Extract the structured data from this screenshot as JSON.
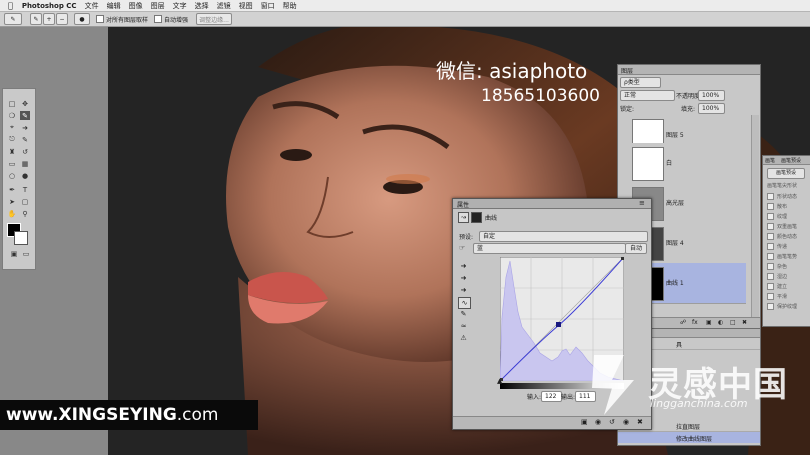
{
  "menubar": {
    "app_name": "Photoshop CC",
    "items": [
      "文件",
      "编辑",
      "图像",
      "图层",
      "文字",
      "选择",
      "滤镜",
      "视图",
      "窗口",
      "帮助"
    ]
  },
  "options_bar": {
    "sample_all_layers": "对所有图层取样",
    "auto_enhance": "自动增强",
    "refine_edge": "调整边缘..."
  },
  "overlay": {
    "wechat_label": "微信:",
    "wechat_id": "asiaphoto",
    "phone": "18565103600",
    "website_main": "www.XINGSEYING",
    "website_tld": ".com",
    "logo_cn": "灵感中国",
    "logo_en": "lingganchina.com"
  },
  "layers_panel": {
    "tab": "图层",
    "filter": "ρ类型",
    "blend_mode": "正常",
    "opacity_label": "不透明度:",
    "opacity": "100%",
    "lock_label": "锁定:",
    "fill_label": "填充:",
    "fill": "100%",
    "layers": [
      {
        "name": "图层 5"
      },
      {
        "name": "白"
      },
      {
        "name": "高光层"
      },
      {
        "name": "图层 4"
      },
      {
        "name": "曲线 1"
      }
    ]
  },
  "brush_panel": {
    "tabs": [
      "画笔",
      "画笔预设"
    ],
    "preset_button": "画笔预设",
    "items": [
      "画笔笔尖形状",
      "形状动态",
      "散布",
      "纹理",
      "双重画笔",
      "颜色动态",
      "传递",
      "画笔笔势",
      "杂色",
      "湿边",
      "建立",
      "平滑",
      "保护纹理"
    ]
  },
  "properties_panel": {
    "tab": "属性",
    "title": "曲线",
    "preset_label": "预设:",
    "preset_value": "自定",
    "channel_value": "蓝",
    "auto_button": "自动",
    "input_label": "输入:",
    "input_value": "122",
    "output_label": "输出:",
    "output_value": "111"
  },
  "history_panel": {
    "items": [
      "具",
      "拉直图层",
      "修改曲线图层"
    ]
  },
  "colors": {
    "canvas_gray": "#888888",
    "panel_gray": "#c8c8c8",
    "selection_blue": "#a8b4e0",
    "curve_blue": "#3b3bd6"
  }
}
